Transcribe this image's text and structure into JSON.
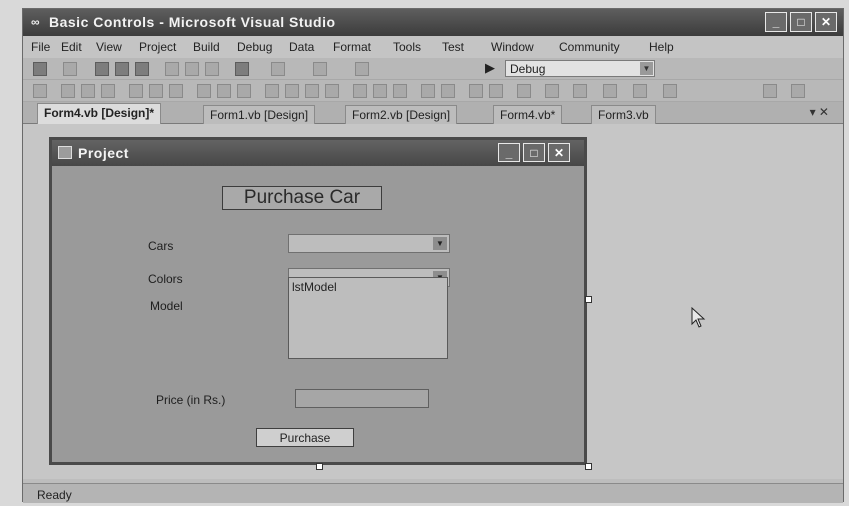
{
  "window": {
    "title": "Basic Controls - Microsoft Visual Studio",
    "controls": {
      "minimize": "_",
      "maximize": "□",
      "close": "✕"
    }
  },
  "menu": [
    "File",
    "Edit",
    "View",
    "Project",
    "Build",
    "Debug",
    "Data",
    "Format",
    "Tools",
    "Test",
    "Window",
    "Community",
    "Help"
  ],
  "toolbar": {
    "configuration": "Debug"
  },
  "tabs": [
    {
      "label": "Form4.vb [Design]*",
      "active": true
    },
    {
      "label": "Form1.vb [Design]",
      "active": false
    },
    {
      "label": "Form2.vb [Design]",
      "active": false
    },
    {
      "label": "Form4.vb*",
      "active": false
    },
    {
      "label": "Form3.vb",
      "active": false
    }
  ],
  "tabstrip_controls": "▾ ✕",
  "form": {
    "title": "Project",
    "heading": "Purchase Car",
    "cars_label": "Cars",
    "colors_label": "Colors",
    "model_label": "Model",
    "model_list_name": "lstModel",
    "price_label": "Price (in Rs.)",
    "purchase_button": "Purchase"
  },
  "status": {
    "text": "Ready"
  },
  "icons": {
    "app": "visual-studio-icon",
    "form": "form-icon",
    "start": "play-icon",
    "dropdown": "chevron-down-icon",
    "pointer": "mouse-cursor-icon"
  },
  "colors": {
    "titlebar": "#4a4a4a",
    "form_client": "#9a9a9a",
    "designer_bg": "#c6c6c6"
  }
}
